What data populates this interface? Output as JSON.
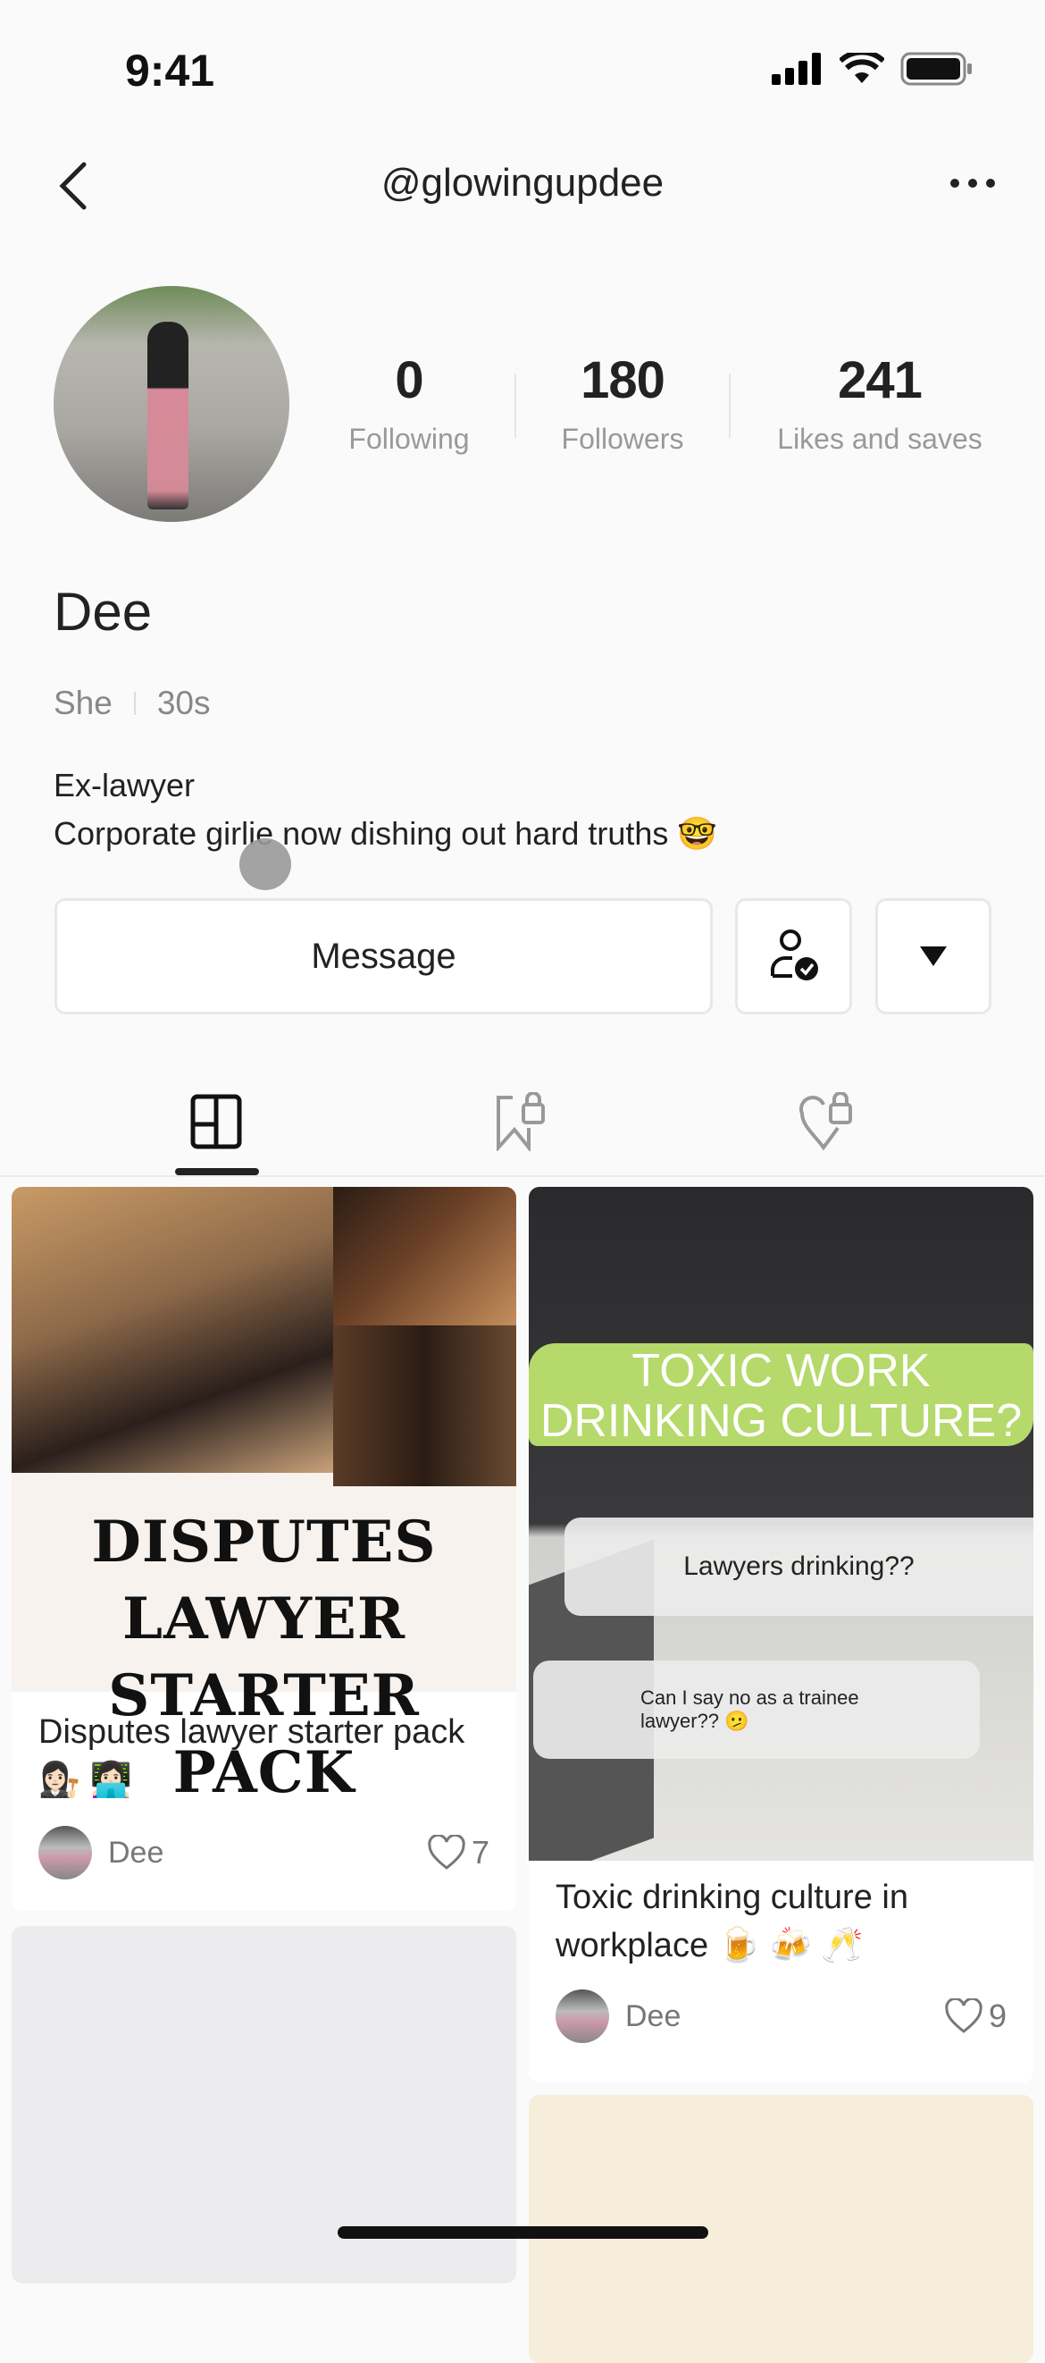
{
  "status_bar": {
    "time": "9:41"
  },
  "header": {
    "username": "@glowingupdee"
  },
  "profile": {
    "stats": [
      {
        "value": "0",
        "label": "Following"
      },
      {
        "value": "180",
        "label": "Followers"
      },
      {
        "value": "241",
        "label": "Likes and saves"
      }
    ],
    "name": "Dee",
    "pronoun": "She",
    "age": "30s",
    "bio_line1": "Ex-lawyer",
    "bio_line2": "Corporate girlie now dishing out hard truths 🤓"
  },
  "actions": {
    "message_label": "Message"
  },
  "tabs": [
    {
      "icon": "notes-grid-icon",
      "active": true
    },
    {
      "icon": "bookmark-lock-icon"
    },
    {
      "icon": "heart-lock-icon"
    }
  ],
  "posts": [
    {
      "cover_text_1": "DISPUTES LAWYER",
      "cover_text_2": "STARTER PACK",
      "title": "Disputes lawyer starter pack 👩🏻‍⚖️ 👩🏻‍💻",
      "author": "Dee",
      "likes": "7"
    },
    {
      "cover_headline_1": "TOXIC WORK",
      "cover_headline_2": "DRINKING CULTURE?",
      "cover_bubble_1": "Lawyers drinking??",
      "cover_bubble_2": "Can I say no as a trainee lawyer?? 🫤",
      "title": "Toxic drinking culture in workplace 🍺 🍻 🥂",
      "author": "Dee",
      "likes": "9"
    }
  ],
  "colors": {
    "accent_text": "#222222",
    "muted": "#999999",
    "highlight_green": "#b5d96a"
  }
}
